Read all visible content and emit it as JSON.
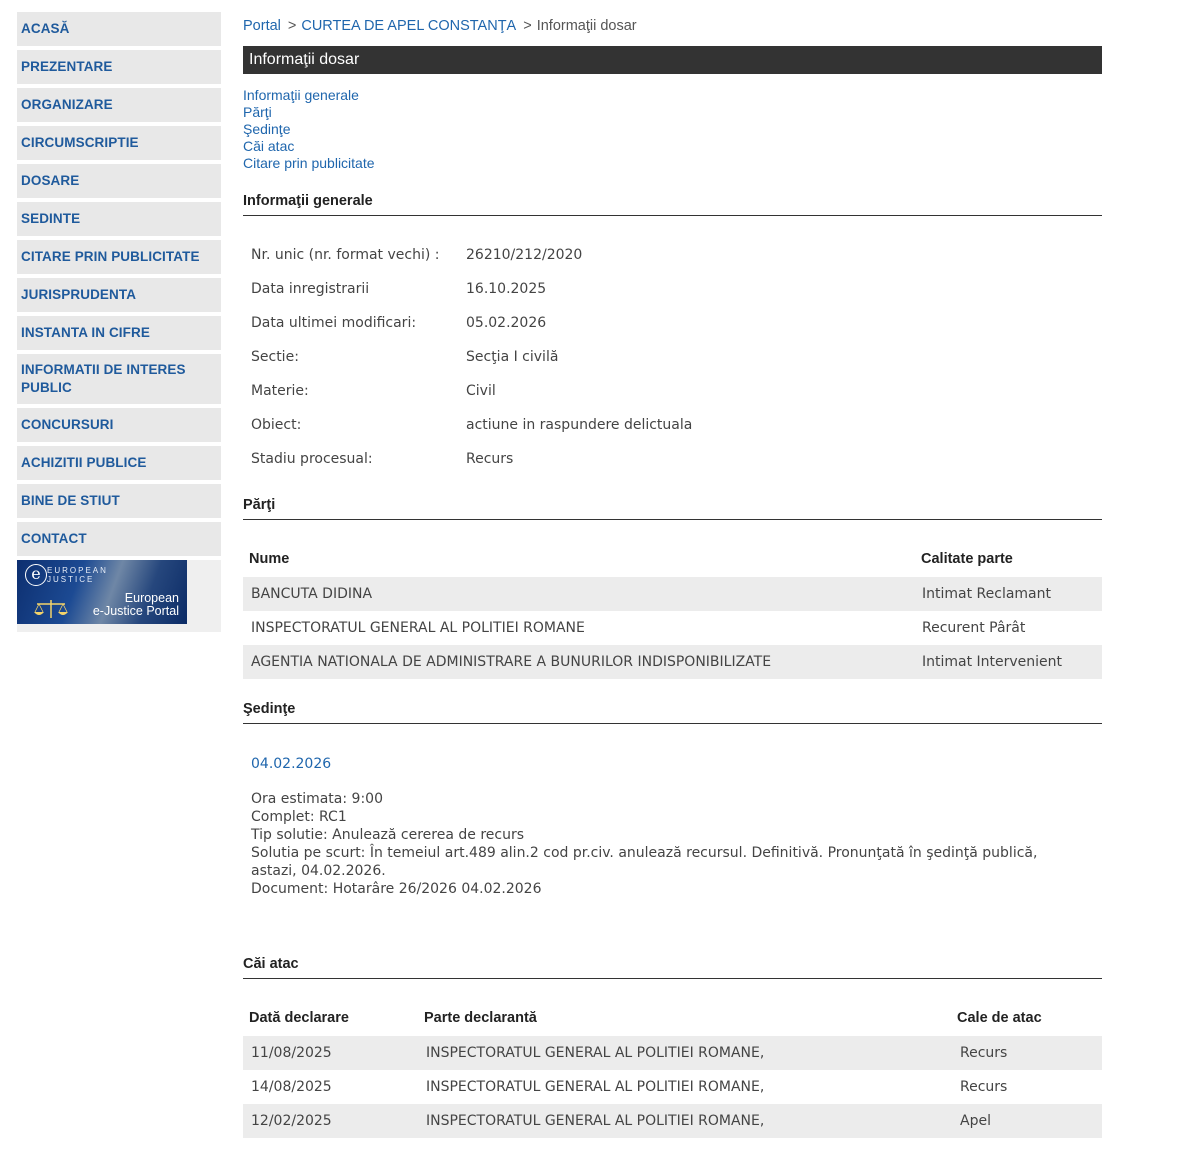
{
  "sidebar": {
    "items": [
      {
        "label": "ACASĂ"
      },
      {
        "label": "PREZENTARE"
      },
      {
        "label": "ORGANIZARE"
      },
      {
        "label": "CIRCUMSCRIPTIE"
      },
      {
        "label": "DOSARE"
      },
      {
        "label": "SEDINTE"
      },
      {
        "label": "CITARE PRIN PUBLICITATE"
      },
      {
        "label": "JURISPRUDENTA"
      },
      {
        "label": "INSTANTA IN CIFRE"
      },
      {
        "label": "INFORMATII DE INTERES PUBLIC"
      },
      {
        "label": "CONCURSURI"
      },
      {
        "label": "ACHIZITII PUBLICE"
      },
      {
        "label": "BINE DE STIUT"
      },
      {
        "label": "CONTACT"
      }
    ],
    "ejustice": {
      "line1": "EUROPEAN",
      "line2": "JUSTICE",
      "bottom1": "European",
      "bottom2": "e-Justice Portal",
      "e_letter": "e"
    }
  },
  "breadcrumb": {
    "home": "Portal",
    "court": "CURTEA DE APEL CONSTANŢA",
    "current": "Informaţii dosar",
    "sep": ">"
  },
  "page_title": "Informaţii dosar",
  "toc": [
    "Informaţii generale",
    "Părţi",
    "Şedinţe",
    "Căi atac",
    "Citare prin publicitate"
  ],
  "general": {
    "heading": "Informaţii generale",
    "rows": [
      {
        "label": "Nr. unic (nr. format vechi) :",
        "value": "26210/212/2020"
      },
      {
        "label": "Data inregistrarii",
        "value": "16.10.2025"
      },
      {
        "label": "Data ultimei modificari:",
        "value": "05.02.2026"
      },
      {
        "label": "Sectie:",
        "value": "Secţia I civilă"
      },
      {
        "label": "Materie:",
        "value": "Civil"
      },
      {
        "label": "Obiect:",
        "value": "actiune in raspundere delictuala"
      },
      {
        "label": "Stadiu procesual:",
        "value": "Recurs"
      }
    ]
  },
  "parti": {
    "heading": "Părţi",
    "col_name": "Nume",
    "col_role": "Calitate parte",
    "rows": [
      {
        "name": "BANCUTA DIDINA",
        "role": "Intimat Reclamant"
      },
      {
        "name": "INSPECTORATUL GENERAL AL POLITIEI ROMANE",
        "role": "Recurent Pârât"
      },
      {
        "name": "AGENTIA NATIONALA DE ADMINISTRARE A BUNURILOR INDISPONIBILIZATE",
        "role": "Intimat Intervenient"
      }
    ]
  },
  "sedinte": {
    "heading": "Şedinţe",
    "date": "04.02.2026",
    "lines": [
      "Ora estimata: 9:00",
      "Complet: RC1",
      "Tip solutie: Anulează cererea de recurs",
      "Solutia pe scurt: În temeiul art.489 alin.2 cod pr.civ. anulează recursul. Definitivă. Pronunţată în şedinţă publică, astazi, 04.02.2026.",
      "Document: Hotarâre  26/2026  04.02.2026"
    ]
  },
  "cai_atac": {
    "heading": "Căi atac",
    "col_date": "Dată declarare",
    "col_party": "Parte declarantă",
    "col_type": "Cale de atac",
    "rows": [
      {
        "date": "11/08/2025",
        "party": "INSPECTORATUL GENERAL AL POLITIEI ROMANE,",
        "type": "Recurs"
      },
      {
        "date": "14/08/2025",
        "party": "INSPECTORATUL GENERAL AL POLITIEI ROMANE,",
        "type": "Recurs"
      },
      {
        "date": "12/02/2025",
        "party": "INSPECTORATUL GENERAL AL POLITIEI ROMANE,",
        "type": "Apel"
      }
    ]
  }
}
